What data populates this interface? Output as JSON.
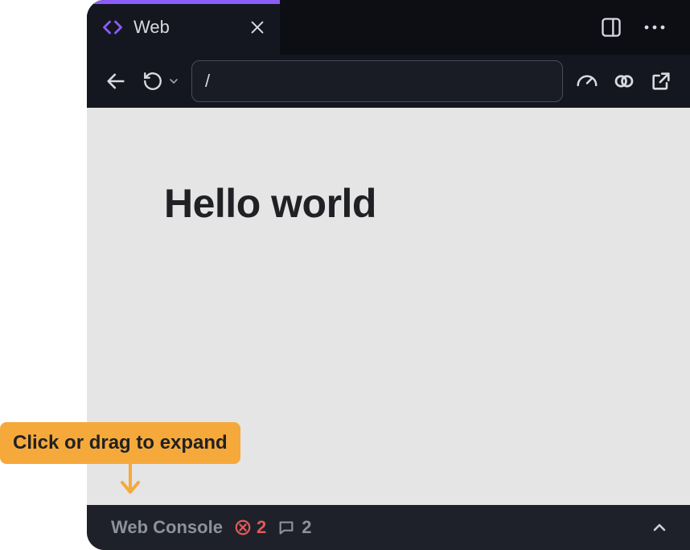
{
  "tab": {
    "title": "Web"
  },
  "url": {
    "value": "/"
  },
  "page": {
    "heading": "Hello world"
  },
  "console": {
    "label": "Web Console",
    "error_count": "2",
    "message_count": "2"
  },
  "callout": {
    "text": "Click or drag to expand"
  }
}
